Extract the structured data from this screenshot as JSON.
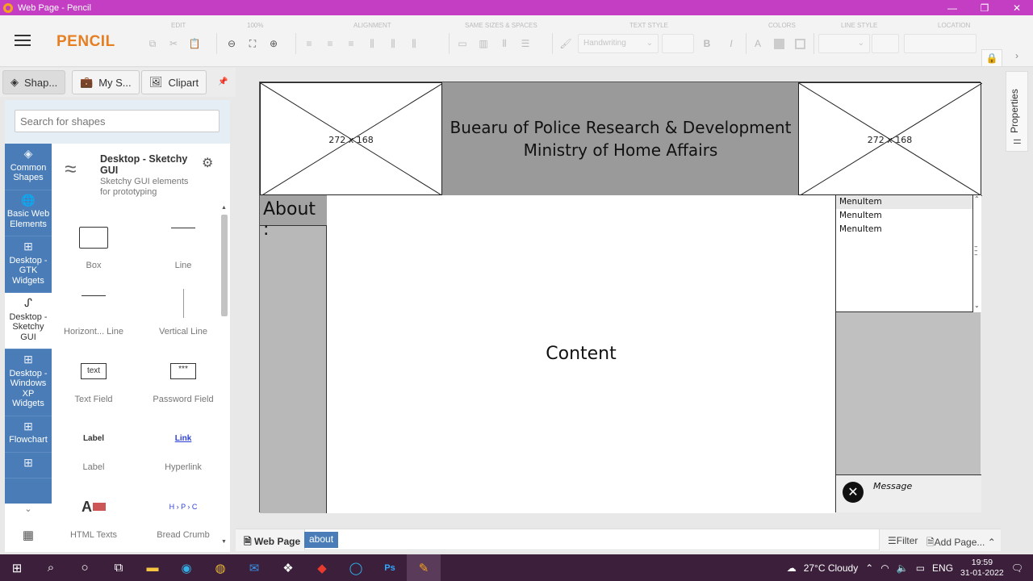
{
  "window": {
    "title": "Web Page - Pencil",
    "min": "—",
    "max": "❐",
    "close": "✕"
  },
  "toolbar": {
    "logo": "PENCIL",
    "groups": {
      "edit": "EDIT",
      "zoom": "100%",
      "alignment": "ALIGNMENT",
      "sizes": "SAME SIZES & SPACES",
      "text_style": "TEXT STYLE",
      "colors": "COLORS",
      "line_style": "LINE STYLE",
      "location": "LOCATION"
    },
    "font_value": "Handwriting",
    "bold": "B",
    "italic": "I",
    "font_color": "A"
  },
  "tabs": {
    "shapes": "Shap...",
    "my_shapes": "My S...",
    "clipart": "Clipart"
  },
  "search": {
    "placeholder": "Search for shapes"
  },
  "collections": [
    {
      "label": "Common Shapes"
    },
    {
      "label": "Basic Web Elements"
    },
    {
      "label": "Desktop - GTK Widgets"
    },
    {
      "label": "Desktop - Sketchy GUI"
    },
    {
      "label": "Desktop - Windows XP Widgets"
    },
    {
      "label": "Flowchart"
    }
  ],
  "collection_info": {
    "name": "Desktop - Sketchy GUI",
    "description": "Sketchy GUI elements for prototyping"
  },
  "shapes": {
    "box": "Box",
    "line": "Line",
    "hline": "Horizont... Line",
    "vline": "Vertical Line",
    "textfield": "Text Field",
    "textfield_preview": "text",
    "password": "Password Field",
    "password_preview": "***",
    "label": "Label",
    "label_preview": "Label",
    "hyperlink": "Hyperlink",
    "hyperlink_preview": "Link",
    "htmltexts": "HTML Texts",
    "breadcrumb": "Bread Crumb",
    "breadcrumb_preview": "H › P › C"
  },
  "canvas": {
    "image_left_dim": "272 x 168",
    "image_right_dim": "272 x 168",
    "header_line1": "Buearu of Police Research & Development",
    "header_line2": "Ministry of Home Affairs",
    "about": "About :",
    "content": "Content",
    "menu_items": [
      "MenuItem",
      "MenuItem",
      "MenuItem"
    ],
    "message": "Message"
  },
  "pagebar": {
    "page": "Web Page",
    "tab": "about",
    "filter": "Filter",
    "add_page": "Add Page..."
  },
  "properties": {
    "label": "Properties"
  },
  "taskbar": {
    "weather": "27°C  Cloudy",
    "lang": "ENG",
    "time": "19:59",
    "date": "31-01-2022"
  }
}
